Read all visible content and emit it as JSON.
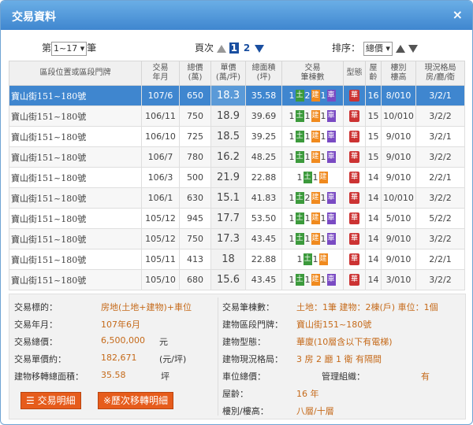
{
  "window": {
    "title": "交易資料",
    "close_glyph": "×"
  },
  "controls": {
    "page_prefix": "第",
    "page_range": "1~17",
    "page_suffix": "筆",
    "pages_label": "頁次",
    "pages": [
      "1",
      "2"
    ],
    "current_page": "1",
    "sort_label": "排序：",
    "sort_value": "總價"
  },
  "table": {
    "headers": {
      "address": "區段位置或區段門牌",
      "date": [
        "交易",
        "年月"
      ],
      "total": [
        "總價",
        "(萬)"
      ],
      "unit": [
        "單價",
        "(萬/坪)"
      ],
      "area": [
        "總面積",
        "(坪)"
      ],
      "counts": [
        "交易",
        "筆棟數"
      ],
      "type": "型態",
      "age": [
        "屋",
        "齡"
      ],
      "floor": [
        "樓別",
        "樓高"
      ],
      "layout": [
        "現況格局",
        "房/廳/衛"
      ]
    },
    "rows": [
      {
        "address": "寶山街151~180號",
        "date": "107/6",
        "total": "650",
        "unit": "18.3",
        "area": "35.58",
        "land": "1",
        "bldg": "2",
        "car": "1",
        "type": "華",
        "age": "16",
        "floor": "8/010",
        "layout": "3/2/1"
      },
      {
        "address": "寶山街151~180號",
        "date": "106/11",
        "total": "750",
        "unit": "18.9",
        "area": "39.69",
        "land": "1",
        "bldg": "1",
        "car": "1",
        "type": "華",
        "age": "15",
        "floor": "10/010",
        "layout": "3/2/2"
      },
      {
        "address": "寶山街151~180號",
        "date": "106/10",
        "total": "725",
        "unit": "18.5",
        "area": "39.25",
        "land": "1",
        "bldg": "1",
        "car": "1",
        "type": "華",
        "age": "15",
        "floor": "9/010",
        "layout": "3/2/1"
      },
      {
        "address": "寶山街151~180號",
        "date": "106/7",
        "total": "780",
        "unit": "16.2",
        "area": "48.25",
        "land": "1",
        "bldg": "1",
        "car": "1",
        "type": "華",
        "age": "15",
        "floor": "9/010",
        "layout": "3/2/2"
      },
      {
        "address": "寶山街151~180號",
        "date": "106/3",
        "total": "500",
        "unit": "21.9",
        "area": "22.88",
        "land": "1",
        "bldg": "1",
        "car": "",
        "type": "華",
        "age": "14",
        "floor": "9/010",
        "layout": "2/2/1"
      },
      {
        "address": "寶山街151~180號",
        "date": "106/1",
        "total": "630",
        "unit": "15.1",
        "area": "41.83",
        "land": "1",
        "bldg": "2",
        "car": "1",
        "type": "華",
        "age": "14",
        "floor": "10/010",
        "layout": "3/2/2"
      },
      {
        "address": "寶山街151~180號",
        "date": "105/12",
        "total": "945",
        "unit": "17.7",
        "area": "53.50",
        "land": "1",
        "bldg": "1",
        "car": "1",
        "type": "華",
        "age": "14",
        "floor": "5/010",
        "layout": "5/2/2"
      },
      {
        "address": "寶山街151~180號",
        "date": "105/12",
        "total": "750",
        "unit": "17.3",
        "area": "43.45",
        "land": "1",
        "bldg": "1",
        "car": "1",
        "type": "華",
        "age": "14",
        "floor": "9/010",
        "layout": "3/2/2"
      },
      {
        "address": "寶山街151~180號",
        "date": "105/11",
        "total": "413",
        "unit": "18",
        "area": "22.88",
        "land": "1",
        "bldg": "1",
        "car": "",
        "type": "華",
        "age": "14",
        "floor": "9/010",
        "layout": "2/2/1"
      },
      {
        "address": "寶山街151~180號",
        "date": "105/10",
        "total": "680",
        "unit": "15.6",
        "area": "43.45",
        "land": "1",
        "bldg": "1",
        "car": "1",
        "type": "華",
        "age": "14",
        "floor": "3/010",
        "layout": "3/2/2"
      }
    ],
    "badge_labels": {
      "land": "土",
      "bldg": "建",
      "car": "車"
    },
    "colors": {
      "selected_row": "#3f86cf",
      "land": "#3c9a3c",
      "bldg": "#f08a1e",
      "car": "#7a4bc3",
      "type": "#cc3333"
    }
  },
  "detail": {
    "target_label": "交易標的：",
    "target_value": "房地(土地+建物)+車位",
    "ym_label": "交易年月：",
    "ym_value": "107年6月",
    "total_label": "交易總價：",
    "total_value": "6,500,000",
    "total_unit": "元",
    "unit_label": "交易單價約：",
    "unit_value": "182,671",
    "unit_unit": "(元/坪)",
    "area_label": "建物移轉總面積：",
    "area_value": "35.58",
    "area_unit": "坪",
    "count_label": "交易筆棟數：",
    "count_value": "土地：1筆 建物：2棟(戶) 車位：1個",
    "addr_label": "建物區段門牌：",
    "addr_value": "寶山街151~180號",
    "type_label": "建物型態：",
    "type_value": "華廈(10層含以下有電梯)",
    "layout_label": "建物現況格局：",
    "layout_value": "3 房 2 廳 1 衛 有隔間",
    "parking_label": "車位總價：",
    "mgmt_label": "管理組織：",
    "mgmt_value": "有",
    "age_label": "屋齡：",
    "age_value": "16 年",
    "floor_label": "樓別/樓高：",
    "floor_value": "八層/十層",
    "btn_detail": "交易明細",
    "btn_history": "※歷次移轉明細"
  }
}
